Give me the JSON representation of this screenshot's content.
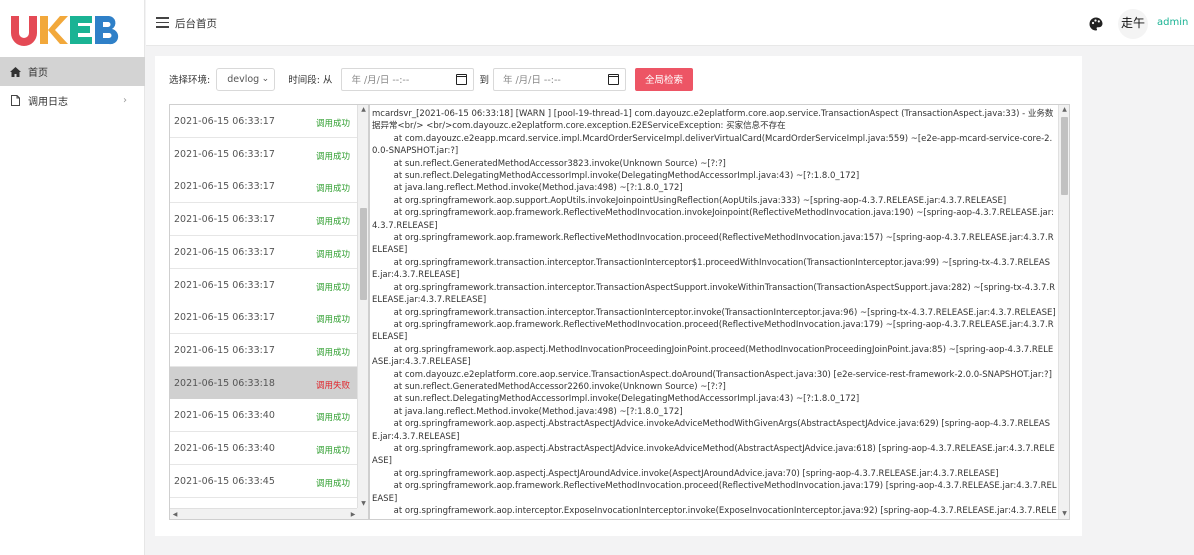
{
  "sidebar": {
    "logo_text": "UKEB",
    "items": [
      {
        "label": "首页",
        "icon": "home-icon",
        "active": true
      },
      {
        "label": "调用日志",
        "icon": "file-icon",
        "arrow": "›"
      }
    ]
  },
  "header": {
    "title": "后台首页",
    "username": "admin",
    "avatar_text": "走午"
  },
  "filter": {
    "env_label": "选择环境:",
    "env_value": "devlog",
    "time_label": "时间段: 从",
    "to_label": "到",
    "date_placeholder_from": "年 /月/日 --:--",
    "date_placeholder_to": "年 /月/日 --:--",
    "search_button": "全局检索"
  },
  "list": [
    {
      "time": "2021-06-15 06:33:17",
      "status": "调用成功",
      "ok": true
    },
    {
      "time": "2021-06-15 06:33:17",
      "status": "调用成功",
      "ok": true
    },
    {
      "time": "2021-06-15 06:33:17",
      "status": "调用成功",
      "ok": true
    },
    {
      "time": "2021-06-15 06:33:17",
      "status": "调用成功",
      "ok": true
    },
    {
      "time": "2021-06-15 06:33:17",
      "status": "调用成功",
      "ok": true
    },
    {
      "time": "2021-06-15 06:33:17",
      "status": "调用成功",
      "ok": true
    },
    {
      "time": "2021-06-15 06:33:17",
      "status": "调用成功",
      "ok": true
    },
    {
      "time": "2021-06-15 06:33:17",
      "status": "调用成功",
      "ok": true
    },
    {
      "time": "2021-06-15 06:33:18",
      "status": "调用失败",
      "ok": false,
      "selected": true
    },
    {
      "time": "2021-06-15 06:33:40",
      "status": "调用成功",
      "ok": true
    },
    {
      "time": "2021-06-15 06:33:40",
      "status": "调用成功",
      "ok": true
    },
    {
      "time": "2021-06-15 06:33:45",
      "status": "调用成功",
      "ok": true
    }
  ],
  "log_lines": [
    "mcardsvr_[2021-06-15 06:33:18] [WARN ] [pool-19-thread-1] com.dayouzc.e2eplatform.core.aop.service.TransactionAspect (TransactionAspect.java:33) - 业务数据异常<br/> <br/>com.dayouzc.e2eplatform.core.exception.E2EServiceException: 买家信息不存在",
    "        at com.dayouzc.e2eapp.mcard.service.impl.McardOrderServiceImpl.deliverVirtualCard(McardOrderServiceImpl.java:559) ~[e2e-app-mcard-service-core-2.0.0-SNAPSHOT.jar:?]",
    "        at sun.reflect.GeneratedMethodAccessor3823.invoke(Unknown Source) ~[?:?]",
    "        at sun.reflect.DelegatingMethodAccessorImpl.invoke(DelegatingMethodAccessorImpl.java:43) ~[?:1.8.0_172]",
    "        at java.lang.reflect.Method.invoke(Method.java:498) ~[?:1.8.0_172]",
    "        at org.springframework.aop.support.AopUtils.invokeJoinpointUsingReflection(AopUtils.java:333) ~[spring-aop-4.3.7.RELEASE.jar:4.3.7.RELEASE]",
    "        at org.springframework.aop.framework.ReflectiveMethodInvocation.invokeJoinpoint(ReflectiveMethodInvocation.java:190) ~[spring-aop-4.3.7.RELEASE.jar:4.3.7.RELEASE]",
    "        at org.springframework.aop.framework.ReflectiveMethodInvocation.proceed(ReflectiveMethodInvocation.java:157) ~[spring-aop-4.3.7.RELEASE.jar:4.3.7.RELEASE]",
    "        at org.springframework.transaction.interceptor.TransactionInterceptor$1.proceedWithInvocation(TransactionInterceptor.java:99) ~[spring-tx-4.3.7.RELEASE.jar:4.3.7.RELEASE]",
    "        at org.springframework.transaction.interceptor.TransactionAspectSupport.invokeWithinTransaction(TransactionAspectSupport.java:282) ~[spring-tx-4.3.7.RELEASE.jar:4.3.7.RELEASE]",
    "        at org.springframework.transaction.interceptor.TransactionInterceptor.invoke(TransactionInterceptor.java:96) ~[spring-tx-4.3.7.RELEASE.jar:4.3.7.RELEASE]",
    "        at org.springframework.aop.framework.ReflectiveMethodInvocation.proceed(ReflectiveMethodInvocation.java:179) ~[spring-aop-4.3.7.RELEASE.jar:4.3.7.RELEASE]",
    "        at org.springframework.aop.aspectj.MethodInvocationProceedingJoinPoint.proceed(MethodInvocationProceedingJoinPoint.java:85) ~[spring-aop-4.3.7.RELEASE.jar:4.3.7.RELEASE]",
    "        at com.dayouzc.e2eplatform.core.aop.service.TransactionAspect.doAround(TransactionAspect.java:30) [e2e-service-rest-framework-2.0.0-SNAPSHOT.jar:?]",
    "        at sun.reflect.GeneratedMethodAccessor2260.invoke(Unknown Source) ~[?:?]",
    "        at sun.reflect.DelegatingMethodAccessorImpl.invoke(DelegatingMethodAccessorImpl.java:43) ~[?:1.8.0_172]",
    "        at java.lang.reflect.Method.invoke(Method.java:498) ~[?:1.8.0_172]",
    "        at org.springframework.aop.aspectj.AbstractAspectJAdvice.invokeAdviceMethodWithGivenArgs(AbstractAspectJAdvice.java:629) [spring-aop-4.3.7.RELEASE.jar:4.3.7.RELEASE]",
    "        at org.springframework.aop.aspectj.AbstractAspectJAdvice.invokeAdviceMethod(AbstractAspectJAdvice.java:618) [spring-aop-4.3.7.RELEASE.jar:4.3.7.RELEASE]",
    "        at org.springframework.aop.aspectj.AspectJAroundAdvice.invoke(AspectJAroundAdvice.java:70) [spring-aop-4.3.7.RELEASE.jar:4.3.7.RELEASE]",
    "        at org.springframework.aop.framework.ReflectiveMethodInvocation.proceed(ReflectiveMethodInvocation.java:179) [spring-aop-4.3.7.RELEASE.jar:4.3.7.RELEASE]",
    "        at org.springframework.aop.interceptor.ExposeInvocationInterceptor.invoke(ExposeInvocationInterceptor.java:92) [spring-aop-4.3.7.RELEASE.jar:4.3.7.RELEASE]",
    "        at org.springframework.aop.framework.ReflectiveMethodInvocation.proceed(ReflectiveMethodInvocation.java:179) [spring-aop-"
  ],
  "colors": {
    "success": "#2e9e2e",
    "fail": "#e0242a",
    "accent": "#1ab394",
    "danger_button": "#ed5565"
  }
}
